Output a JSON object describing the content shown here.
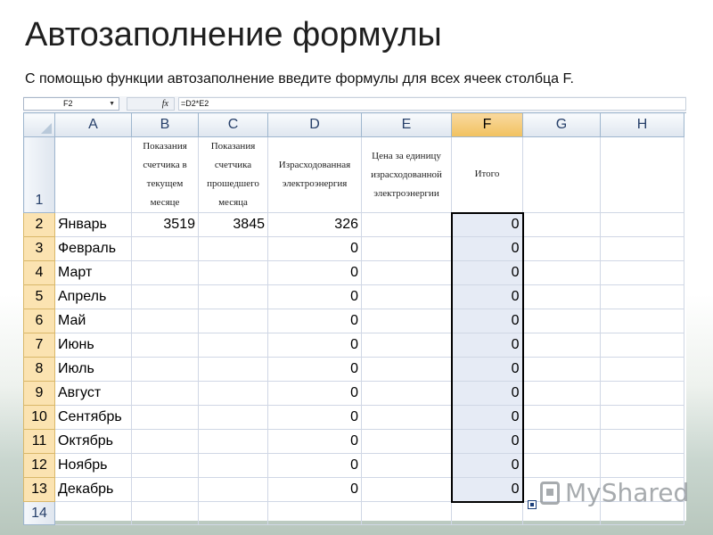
{
  "slide": {
    "title": "Автозаполнение формулы",
    "subtitle": "С помощью функции автозаполнение введите формулы для всех ячеек столбца F."
  },
  "formula_bar": {
    "name_box": "F2",
    "fx_label": "fx",
    "formula": "=D2*E2"
  },
  "columns": [
    "A",
    "B",
    "C",
    "D",
    "E",
    "F",
    "G",
    "H"
  ],
  "header_row": {
    "row_number": "1",
    "b": "Показания счетчика в текущем месяце",
    "c": "Показания счетчика прошедшего месяца",
    "d": "Израсходованная электроэнергия",
    "e": "Цена за единицу израсходованной электроэнергии",
    "f": "Итого"
  },
  "rows": [
    {
      "n": "2",
      "a": "Январь",
      "b": "3519",
      "c": "3845",
      "d": "326",
      "f": "0"
    },
    {
      "n": "3",
      "a": "Февраль",
      "b": "",
      "c": "",
      "d": "0",
      "f": "0"
    },
    {
      "n": "4",
      "a": "Март",
      "b": "",
      "c": "",
      "d": "0",
      "f": "0"
    },
    {
      "n": "5",
      "a": "Апрель",
      "b": "",
      "c": "",
      "d": "0",
      "f": "0"
    },
    {
      "n": "6",
      "a": "Май",
      "b": "",
      "c": "",
      "d": "0",
      "f": "0"
    },
    {
      "n": "7",
      "a": "Июнь",
      "b": "",
      "c": "",
      "d": "0",
      "f": "0"
    },
    {
      "n": "8",
      "a": "Июль",
      "b": "",
      "c": "",
      "d": "0",
      "f": "0"
    },
    {
      "n": "9",
      "a": "Август",
      "b": "",
      "c": "",
      "d": "0",
      "f": "0"
    },
    {
      "n": "10",
      "a": "Сентябрь",
      "b": "",
      "c": "",
      "d": "0",
      "f": "0"
    },
    {
      "n": "11",
      "a": "Октябрь",
      "b": "",
      "c": "",
      "d": "0",
      "f": "0"
    },
    {
      "n": "12",
      "a": "Ноябрь",
      "b": "",
      "c": "",
      "d": "0",
      "f": "0"
    },
    {
      "n": "13",
      "a": "Декабрь",
      "b": "",
      "c": "",
      "d": "0",
      "f": "0"
    }
  ],
  "last_row_number": "14",
  "watermark": "MyShared",
  "colors": {
    "selected_header": "#f1c15f",
    "selected_rows": "#fbe3b1",
    "selected_fill": "#e6ebf5"
  },
  "icons": [
    "dropdown-arrow-icon",
    "fx-icon",
    "select-all-icon",
    "autofill-options-icon",
    "myshared-logo-icon"
  ]
}
